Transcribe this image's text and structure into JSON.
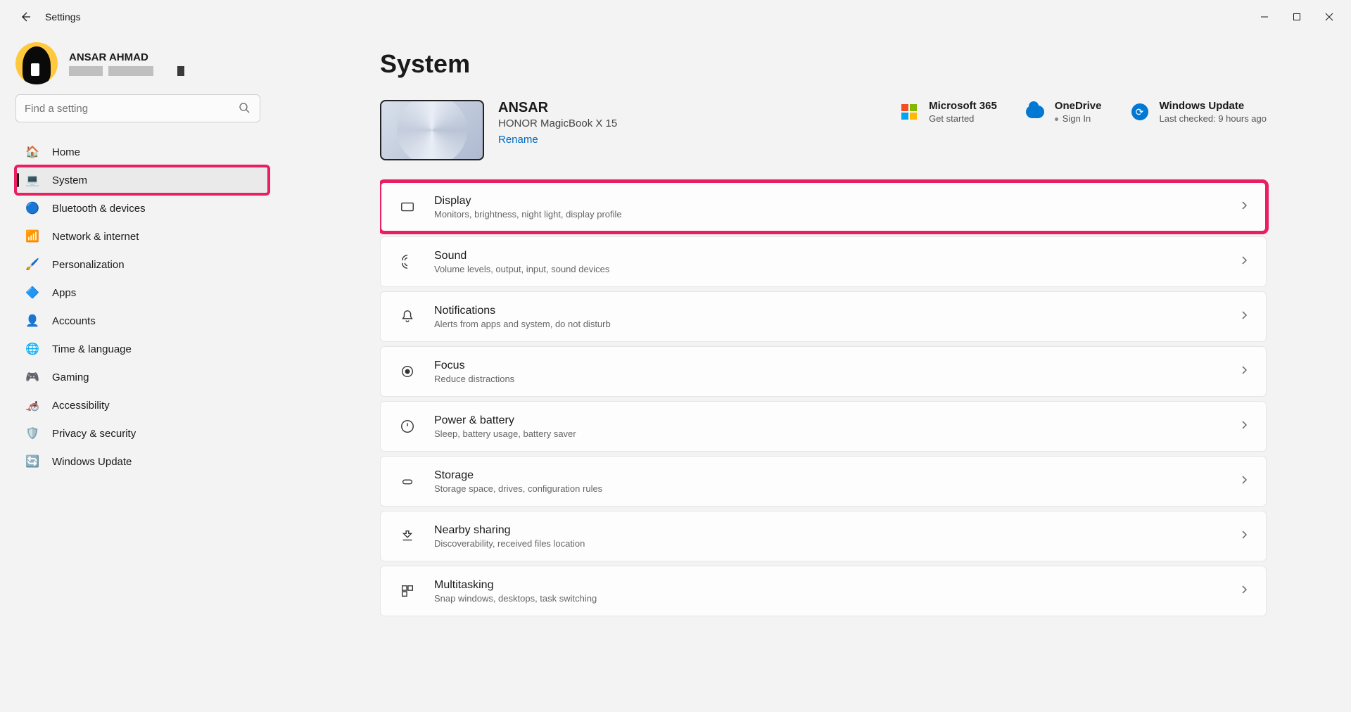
{
  "titlebar": {
    "back_icon": "←",
    "title": "Settings"
  },
  "profile": {
    "name": "ANSAR AHMAD"
  },
  "search": {
    "placeholder": "Find a setting"
  },
  "sidebar": {
    "items": [
      {
        "icon": "🏠",
        "label": "Home"
      },
      {
        "icon": "💻",
        "label": "System"
      },
      {
        "icon": "🔵",
        "label": "Bluetooth & devices"
      },
      {
        "icon": "📶",
        "label": "Network & internet"
      },
      {
        "icon": "🖌️",
        "label": "Personalization"
      },
      {
        "icon": "🔷",
        "label": "Apps"
      },
      {
        "icon": "👤",
        "label": "Accounts"
      },
      {
        "icon": "🌐",
        "label": "Time & language"
      },
      {
        "icon": "🎮",
        "label": "Gaming"
      },
      {
        "icon": "🦽",
        "label": "Accessibility"
      },
      {
        "icon": "🛡️",
        "label": "Privacy & security"
      },
      {
        "icon": "🔄",
        "label": "Windows Update"
      }
    ],
    "selected_index": 1
  },
  "page": {
    "title": "System"
  },
  "device": {
    "name": "ANSAR",
    "model": "HONOR MagicBook X 15",
    "rename": "Rename"
  },
  "tiles": {
    "m365": {
      "title": "Microsoft 365",
      "sub": "Get started"
    },
    "onedrive": {
      "title": "OneDrive",
      "sub": "Sign In"
    },
    "update": {
      "title": "Windows Update",
      "sub": "Last checked: 9 hours ago"
    }
  },
  "cards": [
    {
      "title": "Display",
      "sub": "Monitors, brightness, night light, display profile"
    },
    {
      "title": "Sound",
      "sub": "Volume levels, output, input, sound devices"
    },
    {
      "title": "Notifications",
      "sub": "Alerts from apps and system, do not disturb"
    },
    {
      "title": "Focus",
      "sub": "Reduce distractions"
    },
    {
      "title": "Power & battery",
      "sub": "Sleep, battery usage, battery saver"
    },
    {
      "title": "Storage",
      "sub": "Storage space, drives, configuration rules"
    },
    {
      "title": "Nearby sharing",
      "sub": "Discoverability, received files location"
    },
    {
      "title": "Multitasking",
      "sub": "Snap windows, desktops, task switching"
    }
  ],
  "highlight_card_index": 0,
  "highlight_sidebar_index": 1
}
